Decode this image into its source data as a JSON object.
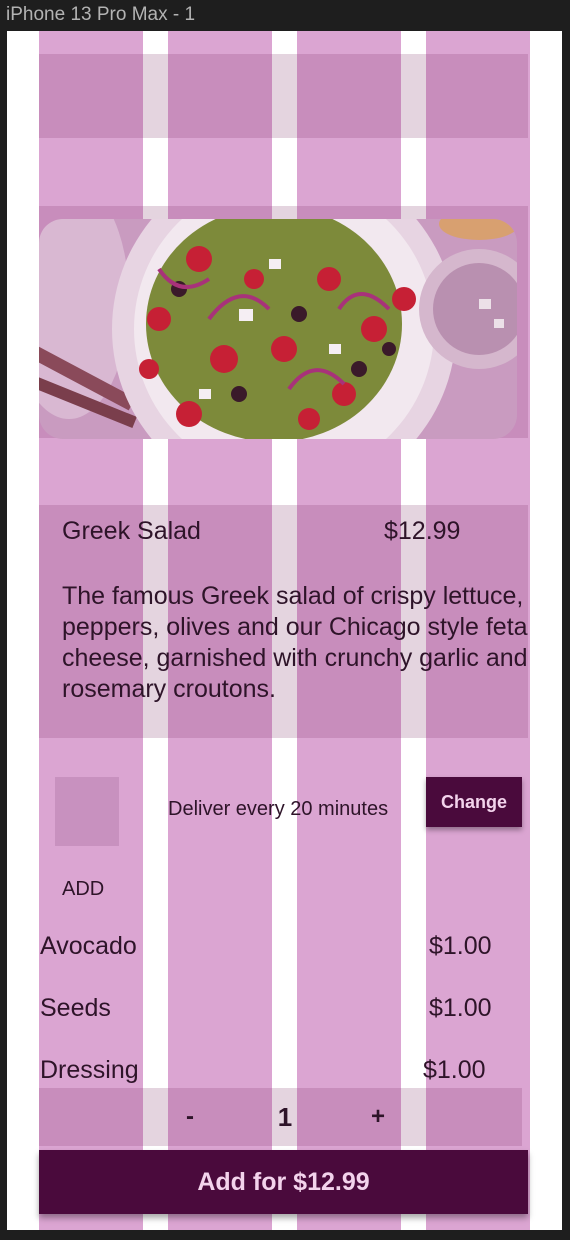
{
  "window": {
    "title": "iPhone 13 Pro Max - 1"
  },
  "product": {
    "name": "Greek Salad",
    "price": "$12.99",
    "description": "The famous Greek salad of crispy lettuce, peppers, olives and our Chicago style feta cheese, garnished with crunchy garlic and rosemary croutons."
  },
  "delivery": {
    "text": "Deliver every 20 minutes",
    "change_label": "Change"
  },
  "addons": {
    "heading": "ADD",
    "items": [
      {
        "name": "Avocado",
        "price": "$1.00"
      },
      {
        "name": "Seeds",
        "price": "$1.00"
      },
      {
        "name": "Dressing",
        "price": "$1.00"
      }
    ]
  },
  "stepper": {
    "minus": "-",
    "quantity": "1",
    "plus": "+"
  },
  "cta": {
    "label": "Add for $12.99"
  },
  "colors": {
    "overlay_column": "#dba5d2",
    "primary": "#4a0a3c",
    "text": "#2e1429"
  }
}
